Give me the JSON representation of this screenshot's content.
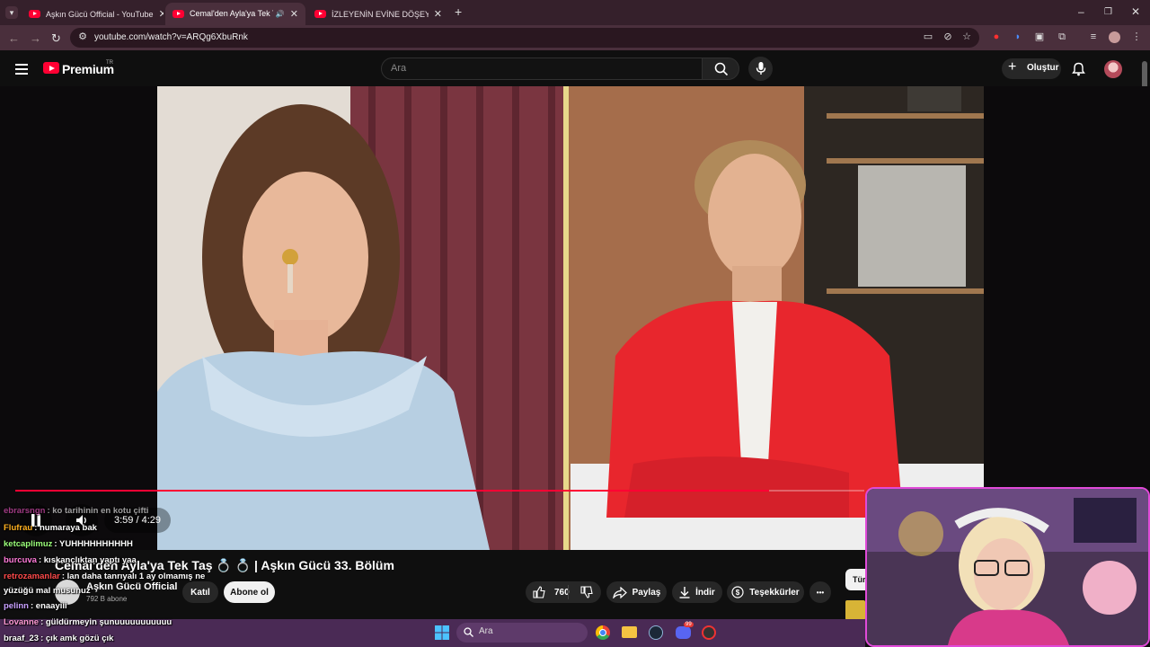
{
  "browser": {
    "tabs": [
      {
        "title": "Aşkın Gücü Official - YouTube",
        "active": false
      },
      {
        "title": "Cemal'den Ayla'ya Tek Taş 💍",
        "active": true
      },
      {
        "title": "İZLEYENİN EVİNE DÖŞEYEN Kİ",
        "active": false
      }
    ],
    "url": "youtube.com/watch?v=ARQg6XbuRnk",
    "new_tab": "+"
  },
  "youtube": {
    "logo_text": "Premium",
    "region": "TR",
    "search_placeholder": "Ara",
    "create_label": "Oluştur"
  },
  "player": {
    "time": "3:59 / 4:29",
    "progress": 0.888
  },
  "video": {
    "title": "Cemal'den Ayla'ya Tek Taş 💍 💍 | Aşkın Gücü 33. Bölüm",
    "channel": "Aşkın Gücü Official",
    "subscribers": "792 B abone",
    "join_label": "Katıl",
    "subscribe_label": "Abone ol",
    "likes": "760",
    "share_label": "Paylaş",
    "download_label": "İndir",
    "thanks_label": "Teşekkürler",
    "more_label": "•••",
    "side_chip": "Tür"
  },
  "chat": [
    {
      "user": "ebrarsngn",
      "msg": ": ko tarihinin en kotu çifti",
      "color": "#ff5ad1"
    },
    {
      "user": "Flufrau",
      "msg": ": numaraya bak",
      "color": "#ffb020"
    },
    {
      "user": "ketcaplimuz",
      "msg": ": YUHHHHHHHHHH",
      "color": "#9bff7a"
    },
    {
      "user": "burcuva",
      "msg": ": kıskançlıktan yaptı yaa",
      "color": "#ff7ad9"
    },
    {
      "user": "retrozamanlar",
      "msg": ": lan daha tanrıyalı 1 ay olmamış ne",
      "color": "#ff4a4a"
    },
    {
      "user": "yüzüğü mal musunuz",
      "msg": "",
      "color": "#ffffff"
    },
    {
      "user": "pelinn",
      "msg": ": enaayiii",
      "color": "#c8a0ff"
    },
    {
      "user": "Lovanne",
      "msg": ": güldürmeyin şunuuuuuuuuuuu",
      "color": "#ff9ad4"
    },
    {
      "user": "braaf_23",
      "msg": ": çık amk gözü çık",
      "color": "#ffffff"
    }
  ],
  "taskbar": {
    "search_placeholder": "Ara",
    "badge": "99"
  },
  "colors": {
    "accent_red": "#ff0033",
    "chrome_bg": "#35202b",
    "taskbar_bg": "#4a2a55",
    "webcam_border": "#e04ad8"
  },
  "icons": [
    "menu-icon",
    "search-icon",
    "mic-icon",
    "bell-icon",
    "like-icon",
    "dislike-icon",
    "share-icon",
    "download-icon",
    "thanks-icon",
    "pause-icon",
    "volume-icon",
    "windows-icon",
    "chrome-icon",
    "folder-icon",
    "steam-icon",
    "discord-icon"
  ]
}
